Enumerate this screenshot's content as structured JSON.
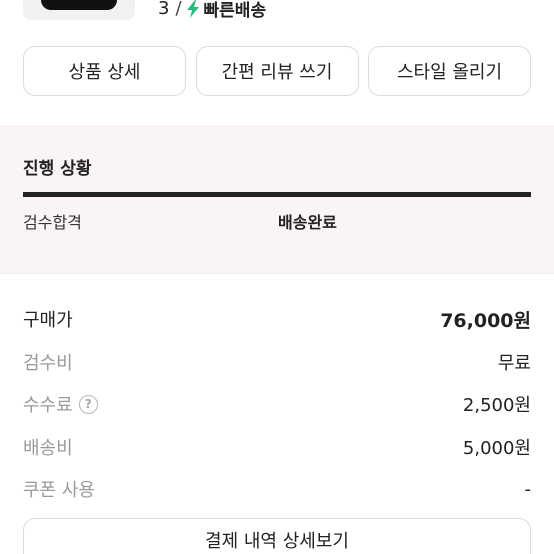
{
  "product": {
    "size": "3",
    "separator": "/",
    "delivery_label": "빠른배송",
    "bolt_color": "#2db87d"
  },
  "actions": [
    {
      "label": "상품 상세"
    },
    {
      "label": "간편 리뷰 쓰기"
    },
    {
      "label": "스타일 올리기"
    }
  ],
  "progress": {
    "title": "진행 상황",
    "steps": [
      "검수합격",
      "배송완료"
    ],
    "active_step": "배송완료"
  },
  "price": {
    "rows": [
      {
        "label": "구매가",
        "value": "76,000원"
      },
      {
        "label": "검수비",
        "value": "무료"
      },
      {
        "label": "수수료",
        "value": "2,500원",
        "help_icon": "?"
      },
      {
        "label": "배송비",
        "value": "5,000원"
      },
      {
        "label": "쿠폰 사용",
        "value": "-"
      }
    ]
  },
  "detail_button": {
    "label": "결제 내역 상세보기"
  }
}
